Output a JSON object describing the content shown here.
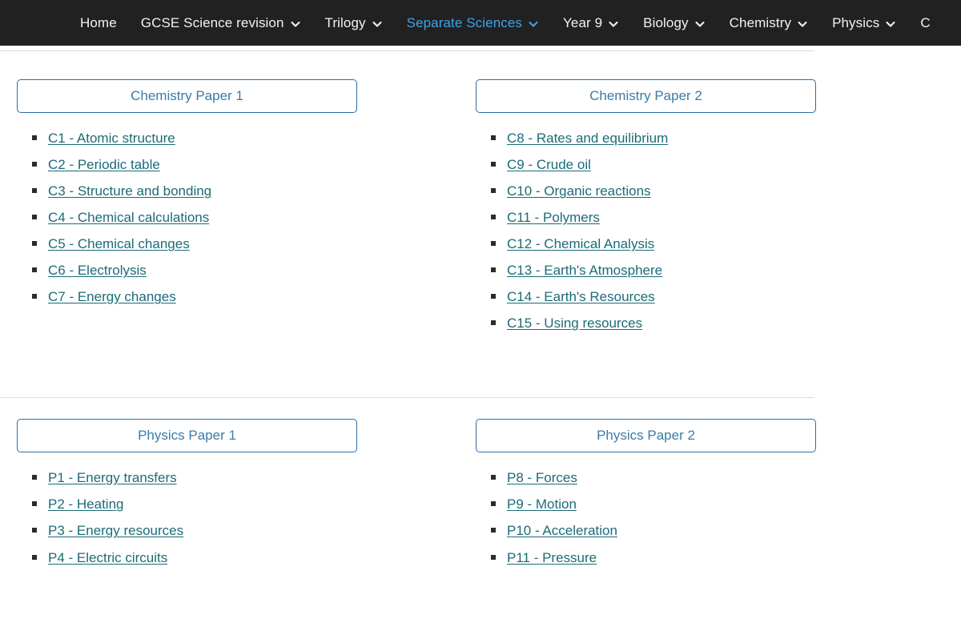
{
  "navbar": {
    "items": [
      {
        "label": "Home",
        "has_caret": false,
        "active": false,
        "icon": ""
      },
      {
        "label": "GCSE Science revision",
        "has_caret": true,
        "active": false,
        "icon": "chevron-down-icon"
      },
      {
        "label": "Trilogy",
        "has_caret": true,
        "active": false,
        "icon": "chevron-down-icon"
      },
      {
        "label": "Separate Sciences",
        "has_caret": true,
        "active": true,
        "icon": "chevron-down-icon"
      },
      {
        "label": "Year 9",
        "has_caret": true,
        "active": false,
        "icon": "chevron-down-icon"
      },
      {
        "label": "Biology",
        "has_caret": true,
        "active": false,
        "icon": "chevron-down-icon"
      },
      {
        "label": "Chemistry",
        "has_caret": true,
        "active": false,
        "icon": "chevron-down-icon"
      },
      {
        "label": "Physics",
        "has_caret": true,
        "active": false,
        "icon": "chevron-down-icon"
      },
      {
        "label": "C",
        "has_caret": false,
        "active": false,
        "icon": ""
      }
    ],
    "background_color": "#212121",
    "text_color": "#f2f2f2",
    "active_color": "#3fa2e8"
  },
  "colors": {
    "box_border": "#2f6da3",
    "box_text": "#3a7ca8",
    "link": "#1c6b77",
    "bullet": "#2b2b2b",
    "divider": "#dcdcdc"
  },
  "sections": [
    {
      "name": "chemistry",
      "columns": [
        {
          "heading": "Chemistry Paper 1",
          "topics": [
            "C1 - Atomic structure",
            "C2 - Periodic table",
            "C3 - Structure and bonding",
            "C4 - Chemical calculations",
            "C5 - Chemical changes",
            "C6 - Electrolysis",
            "C7 - Energy changes"
          ]
        },
        {
          "heading": "Chemistry Paper 2",
          "topics": [
            "C8 - Rates and equilibrium",
            "C9 - Crude oil",
            "C10 - Organic reactions",
            "C11 - Polymers",
            "C12 - Chemical Analysis",
            "C13 - Earth's Atmosphere",
            "C14 - Earth's Resources",
            "C15 - Using resources"
          ]
        }
      ]
    },
    {
      "name": "physics",
      "columns": [
        {
          "heading": "Physics Paper 1",
          "topics": [
            "P1 - Energy transfers",
            "P2 - Heating",
            "P3 - Energy resources",
            "P4 - Electric circuits"
          ]
        },
        {
          "heading": "Physics Paper 2",
          "topics": [
            "P8 - Forces",
            "P9 - Motion",
            "P10 - Acceleration",
            "P11 - Pressure"
          ]
        }
      ]
    }
  ]
}
